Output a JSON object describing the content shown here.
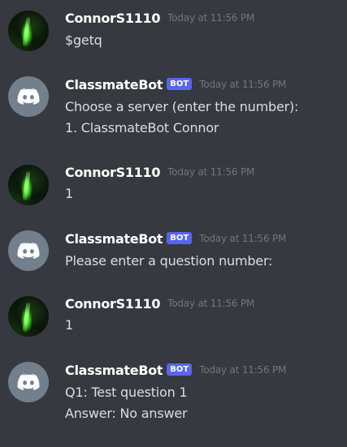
{
  "messages": [
    {
      "author": "ConnorS1110",
      "is_bot": false,
      "timestamp": "Today at 11:56 PM",
      "lines": [
        "$getq"
      ]
    },
    {
      "author": "ClassmateBot",
      "is_bot": true,
      "bot_tag": "BOT",
      "timestamp": "Today at 11:56 PM",
      "lines": [
        "Choose a server (enter the number):",
        "1. ClassmateBot Connor"
      ]
    },
    {
      "author": "ConnorS1110",
      "is_bot": false,
      "timestamp": "Today at 11:56 PM",
      "lines": [
        "1"
      ]
    },
    {
      "author": "ClassmateBot",
      "is_bot": true,
      "bot_tag": "BOT",
      "timestamp": "Today at 11:56 PM",
      "lines": [
        "Please enter a question number:"
      ]
    },
    {
      "author": "ConnorS1110",
      "is_bot": false,
      "timestamp": "Today at 11:56 PM",
      "lines": [
        "1"
      ]
    },
    {
      "author": "ClassmateBot",
      "is_bot": true,
      "bot_tag": "BOT",
      "timestamp": "Today at 11:56 PM",
      "lines": [
        "Q1: Test question 1",
        "Answer: No answer"
      ]
    }
  ],
  "colors": {
    "background": "#36393f",
    "username": "#ffffff",
    "message_text": "#dcddde",
    "timestamp": "#72767d",
    "bot_tag": "#5865f2",
    "bot_avatar": "#747f8d"
  },
  "icons": {
    "bot_avatar": "discord-logo-icon",
    "user_avatar": "green-lightsaber-avatar"
  }
}
